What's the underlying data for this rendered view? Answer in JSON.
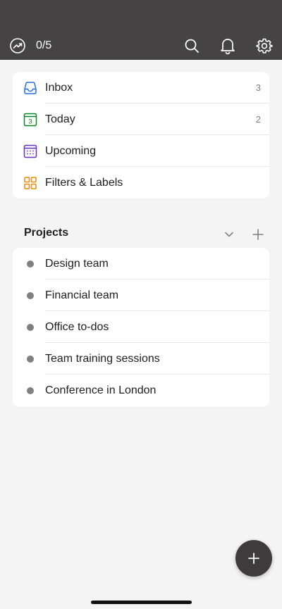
{
  "header": {
    "karma_icon": "trend-up-icon",
    "karma_progress": "0/5",
    "actions": [
      {
        "name": "search",
        "icon": "search-icon"
      },
      {
        "name": "notifications",
        "icon": "bell-icon"
      },
      {
        "name": "settings",
        "icon": "gear-icon"
      }
    ]
  },
  "nav": {
    "items": [
      {
        "label": "Inbox",
        "count": "3",
        "icon": "inbox-icon",
        "color": "#246fe0"
      },
      {
        "label": "Today",
        "count": "2",
        "icon": "calendar-today-icon",
        "icon_text": "3",
        "color": "#058527"
      },
      {
        "label": "Upcoming",
        "count": "",
        "icon": "calendar-upcoming-icon",
        "color": "#692fc2"
      },
      {
        "label": "Filters & Labels",
        "count": "",
        "icon": "filters-grid-icon",
        "color": "#eb8909"
      }
    ]
  },
  "projects": {
    "title": "Projects",
    "collapse_icon": "chevron-down-icon",
    "add_icon": "plus-icon",
    "dot_color": "#808080",
    "items": [
      {
        "label": "Design team"
      },
      {
        "label": "Financial team"
      },
      {
        "label": "Office to-dos"
      },
      {
        "label": "Team training sessions"
      },
      {
        "label": "Conference in London"
      }
    ]
  },
  "fab": {
    "icon": "plus-icon"
  },
  "colors": {
    "header_bg": "#454343",
    "page_bg": "#f5f4f4",
    "card_bg": "#ffffff",
    "fab_bg": "#3d3b3b"
  }
}
